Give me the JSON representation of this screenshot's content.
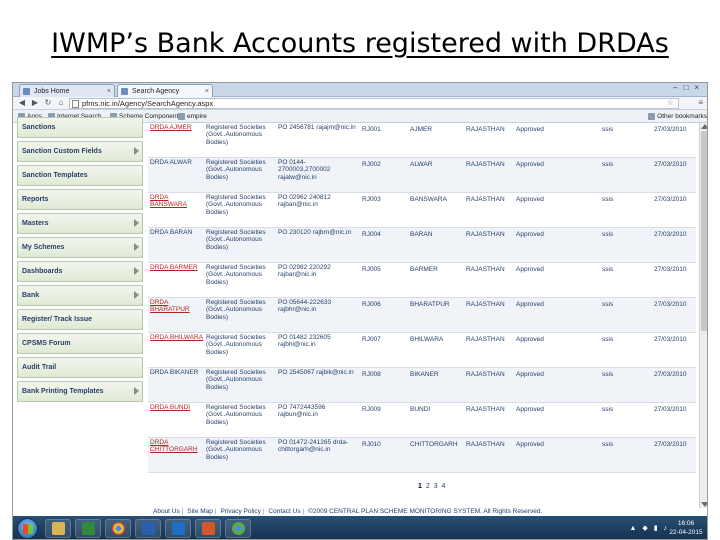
{
  "slide": {
    "title": "IWMP’s Bank Accounts registered with DRDAs"
  },
  "browser": {
    "tabs": [
      {
        "label": "Jobs Home",
        "active": false
      },
      {
        "label": "Search Agency",
        "active": true
      }
    ],
    "url": "pfms.nic.in/Agency/SearchAgency.aspx",
    "bookmarks": [
      "Apps",
      "Internet Search",
      "Scheme Component",
      "empire"
    ],
    "other_bookmarks": "Other bookmarks"
  },
  "sidebar": {
    "items": [
      {
        "label": "Sanctions",
        "has_arrow": false
      },
      {
        "label": "Sanction Custom Fields",
        "has_arrow": true
      },
      {
        "label": "Sanction Templates",
        "has_arrow": false
      },
      {
        "label": "Reports",
        "has_arrow": false
      },
      {
        "label": "Masters",
        "has_arrow": true
      },
      {
        "label": "My Schemes",
        "has_arrow": true
      },
      {
        "label": "Dashboards",
        "has_arrow": true
      },
      {
        "label": "Bank",
        "has_arrow": true
      },
      {
        "label": "Register/ Track Issue",
        "has_arrow": false
      },
      {
        "label": "CPSMS Forum",
        "has_arrow": false
      },
      {
        "label": "Audit Trail",
        "has_arrow": false
      },
      {
        "label": "Bank Printing Templates",
        "has_arrow": true
      }
    ]
  },
  "rows": [
    {
      "name": "DRDA AJMER",
      "name_link": true,
      "type": "Registered Societies (Govt..Autonomous Bodies)",
      "contact": "PO 2456781 rajajm@nic.in",
      "code": "RJ001",
      "district": "AJMER",
      "state": "RAJASTHAN",
      "status": "Approved",
      "scheme": "ssis",
      "date": "27/03/2010"
    },
    {
      "name": "DRDA ALWAR",
      "name_link": false,
      "type": "Registered Societies (Govt..Autonomous Bodies)",
      "contact": "PO 0144-2700003,2700002 rajalw@nic.in",
      "code": "RJ002",
      "district": "ALWAR",
      "state": "RAJASTHAN",
      "status": "Approved",
      "scheme": "ssis",
      "date": "27/03/2010"
    },
    {
      "name": "DRDA BANSWARA",
      "name_link": true,
      "type": "Registered Societies (Govt..Autonomous Bodies)",
      "contact": "PO 02962 240812 rajban@nic.in",
      "code": "RJ003",
      "district": "BANSWARA",
      "state": "RAJASTHAN",
      "status": "Approved",
      "scheme": "ssis",
      "date": "27/03/2010"
    },
    {
      "name": "DRDA BARAN",
      "name_link": false,
      "type": "Registered Societies (Govt..Autonomous Bodies)",
      "contact": "PO 230120 rajbrn@nic.in",
      "code": "RJ004",
      "district": "BARAN",
      "state": "RAJASTHAN",
      "status": "Approved",
      "scheme": "ssis",
      "date": "27/03/2010"
    },
    {
      "name": "DRDA BARMER",
      "name_link": true,
      "type": "Registered Societies (Govt..Autonomous Bodies)",
      "contact": "PO 02982 220292 rajbar@nic.in",
      "code": "RJ005",
      "district": "BARMER",
      "state": "RAJASTHAN",
      "status": "Approved",
      "scheme": "ssis",
      "date": "27/03/2010"
    },
    {
      "name": "DRDA BHARATPUR",
      "name_link": true,
      "type": "Registered Societies (Govt..Autonomous Bodies)",
      "contact": "PO 05644-222633 rajbhr@nic.in",
      "code": "RJ006",
      "district": "BHARATPUR",
      "state": "RAJASTHAN",
      "status": "Approved",
      "scheme": "ssis",
      "date": "27/03/2010"
    },
    {
      "name": "DRDA BHILWARA",
      "name_link": true,
      "type": "Registered Societies (Govt..Autonomous Bodies)",
      "contact": "PO 01482 232605 rajbhl@nic.in",
      "code": "RJ007",
      "district": "BHILWARA",
      "state": "RAJASTHAN",
      "status": "Approved",
      "scheme": "ssis",
      "date": "27/03/2010"
    },
    {
      "name": "DRDA BIKANER",
      "name_link": false,
      "type": "Registered Societies (Govt..Autonomous Bodies)",
      "contact": "PO 2545067 rajbik@nic.in",
      "code": "RJ008",
      "district": "BIKANER",
      "state": "RAJASTHAN",
      "status": "Approved",
      "scheme": "ssis",
      "date": "27/03/2010"
    },
    {
      "name": "DRDA BUNDI",
      "name_link": true,
      "type": "Registered Societies (Govt..Autonomous Bodies)",
      "contact": "PO 7472443596 rajbun@nic.in",
      "code": "RJ009",
      "district": "BUNDI",
      "state": "RAJASTHAN",
      "status": "Approved",
      "scheme": "ssis",
      "date": "27/03/2010"
    },
    {
      "name": "DRDA CHITTORGARH",
      "name_link": true,
      "type": "Registered Societies (Govt..Autonomous Bodies)",
      "contact": "PO 01472-241265 drda-chittorgarh@nic.in",
      "code": "RJ010",
      "district": "CHITTORGARH",
      "state": "RAJASTHAN",
      "status": "Approved",
      "scheme": "ssis",
      "date": "27/03/2010"
    }
  ],
  "pager": {
    "current": "1",
    "pages": "2 3 4"
  },
  "footer": {
    "links": [
      "About Us",
      "Site Map",
      "Privacy Policy",
      "Contact Us"
    ],
    "copyright": "©2009 CENTRAL PLAN SCHEME MONITORING SYSTEM, All Rights Reserved."
  },
  "taskbar": {
    "time": "16:06",
    "date": "22-04-2015"
  }
}
